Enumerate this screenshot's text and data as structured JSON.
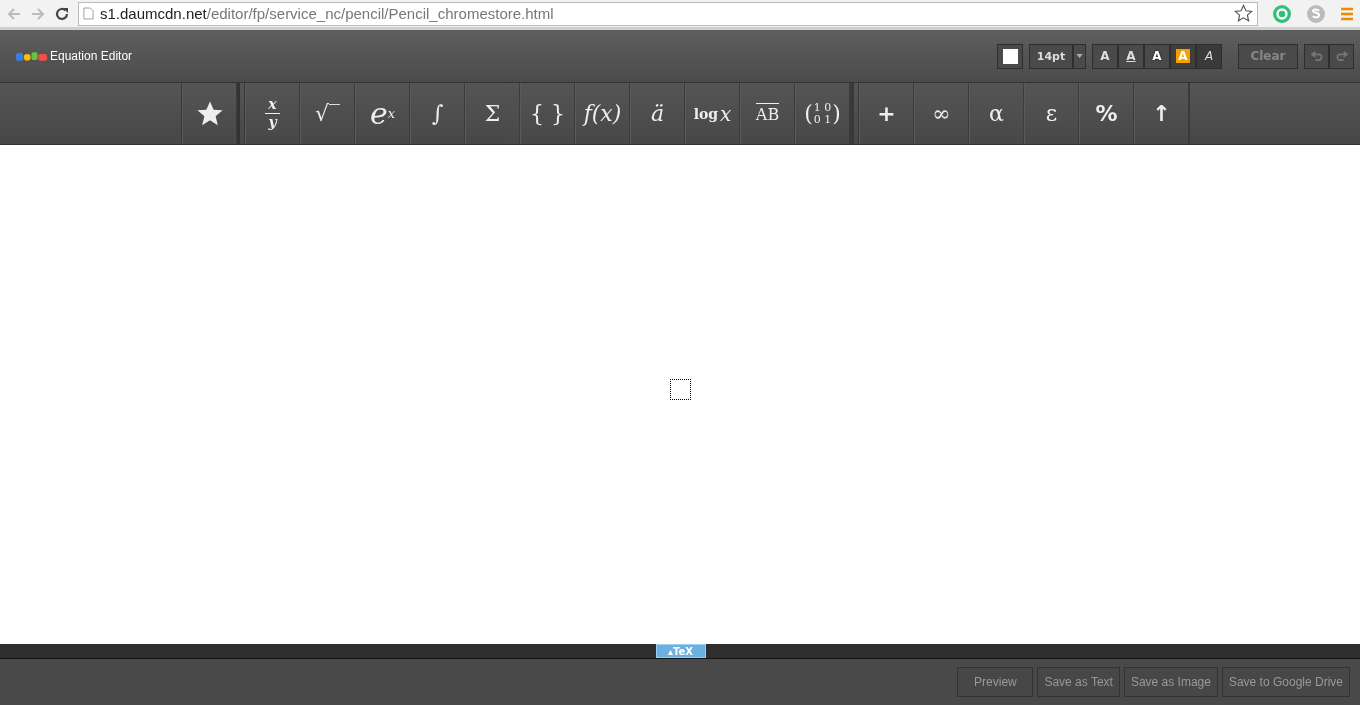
{
  "browser": {
    "url_host": "s1.daumcdn.net",
    "url_path": "/editor/fp/service_nc/pencil/Pencil_chromestore.html"
  },
  "header": {
    "title": "Equation Editor",
    "font_size": "14pt",
    "styles": [
      {
        "label": "A",
        "kind": "bold"
      },
      {
        "label": "A",
        "kind": "underline"
      },
      {
        "label": "A",
        "kind": "outline"
      },
      {
        "label": "A",
        "kind": "highlight"
      },
      {
        "label": "A",
        "kind": "italic"
      }
    ],
    "clear": "Clear"
  },
  "toolbar": {
    "groups": [
      [
        {
          "kind": "star"
        }
      ],
      [
        {
          "kind": "fraction",
          "num": "x",
          "den": "y"
        },
        {
          "kind": "text",
          "label": "√‾"
        },
        {
          "kind": "sup",
          "base": "e",
          "sup": "x"
        },
        {
          "kind": "italic",
          "label": "∫"
        },
        {
          "kind": "text",
          "label": "Σ"
        },
        {
          "kind": "text",
          "label": "{ }"
        },
        {
          "kind": "italic",
          "label": "f(x)"
        },
        {
          "kind": "italic",
          "label": "ä"
        },
        {
          "kind": "log",
          "base": "log",
          "sup": "x"
        },
        {
          "kind": "vector",
          "label": "AB"
        },
        {
          "kind": "matrix",
          "open": "(",
          "rows": [
            "1 0",
            "0 1"
          ],
          "close": ")"
        }
      ],
      [
        {
          "kind": "bold",
          "label": "+"
        },
        {
          "kind": "text",
          "label": "∞"
        },
        {
          "kind": "text",
          "label": "α"
        },
        {
          "kind": "text",
          "label": "ε"
        },
        {
          "kind": "bold",
          "label": "%"
        },
        {
          "kind": "bold",
          "label": "↑"
        }
      ]
    ]
  },
  "tex_tab": "▴TeX",
  "footer": {
    "buttons": [
      "Preview",
      "Save as Text",
      "Save as Image",
      "Save to Google Drive"
    ]
  }
}
